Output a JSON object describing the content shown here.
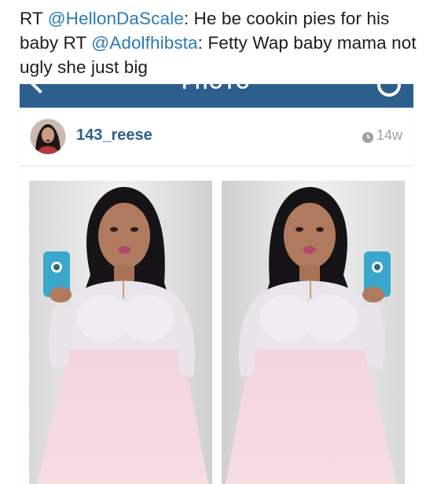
{
  "tweet": {
    "prefix_rt": "RT ",
    "mention1": "@HellonDaScale",
    "text1": ": He be cookin pies for his baby RT ",
    "mention2": "@Adolfhibsta",
    "text2": ": Fetty Wap baby mama not ugly she just big"
  },
  "instagram": {
    "bar_title": "PHOTO",
    "username": "143_reese",
    "time_ago": "14w",
    "accent_color": "#2d5f8e"
  }
}
